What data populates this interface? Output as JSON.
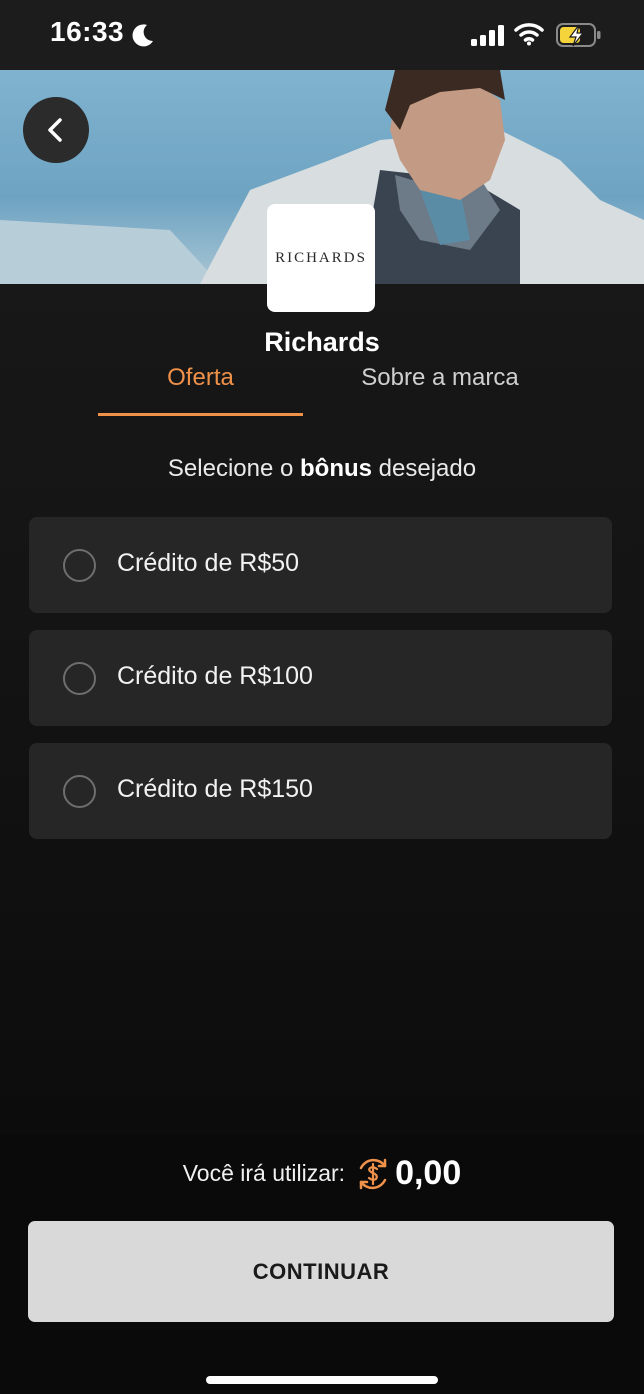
{
  "status_bar": {
    "time": "16:33",
    "icons": [
      "moon-icon",
      "signal-icon",
      "wifi-icon",
      "battery-charging-icon"
    ]
  },
  "header": {
    "back_icon": "chevron-left-icon",
    "brand_logo_text": "RICHARDS",
    "brand_name": "Richards"
  },
  "tabs": [
    {
      "label": "Oferta",
      "active": true
    },
    {
      "label": "Sobre a marca",
      "active": false
    }
  ],
  "instruction": {
    "prefix": "Selecione o ",
    "bold": "bônus",
    "suffix": " desejado"
  },
  "options": [
    {
      "label": "Crédito de R$50",
      "selected": false
    },
    {
      "label": "Crédito de R$100",
      "selected": false
    },
    {
      "label": "Crédito de R$150",
      "selected": false
    }
  ],
  "footer": {
    "usage_label": "Você irá utilizar:",
    "coin_icon": "coin-icon",
    "usage_amount": "0,00",
    "continue_label": "CONTINUAR"
  },
  "colors": {
    "accent": "#f0914a",
    "background": "#141414",
    "card": "#262626",
    "button": "#d9d9d9"
  }
}
